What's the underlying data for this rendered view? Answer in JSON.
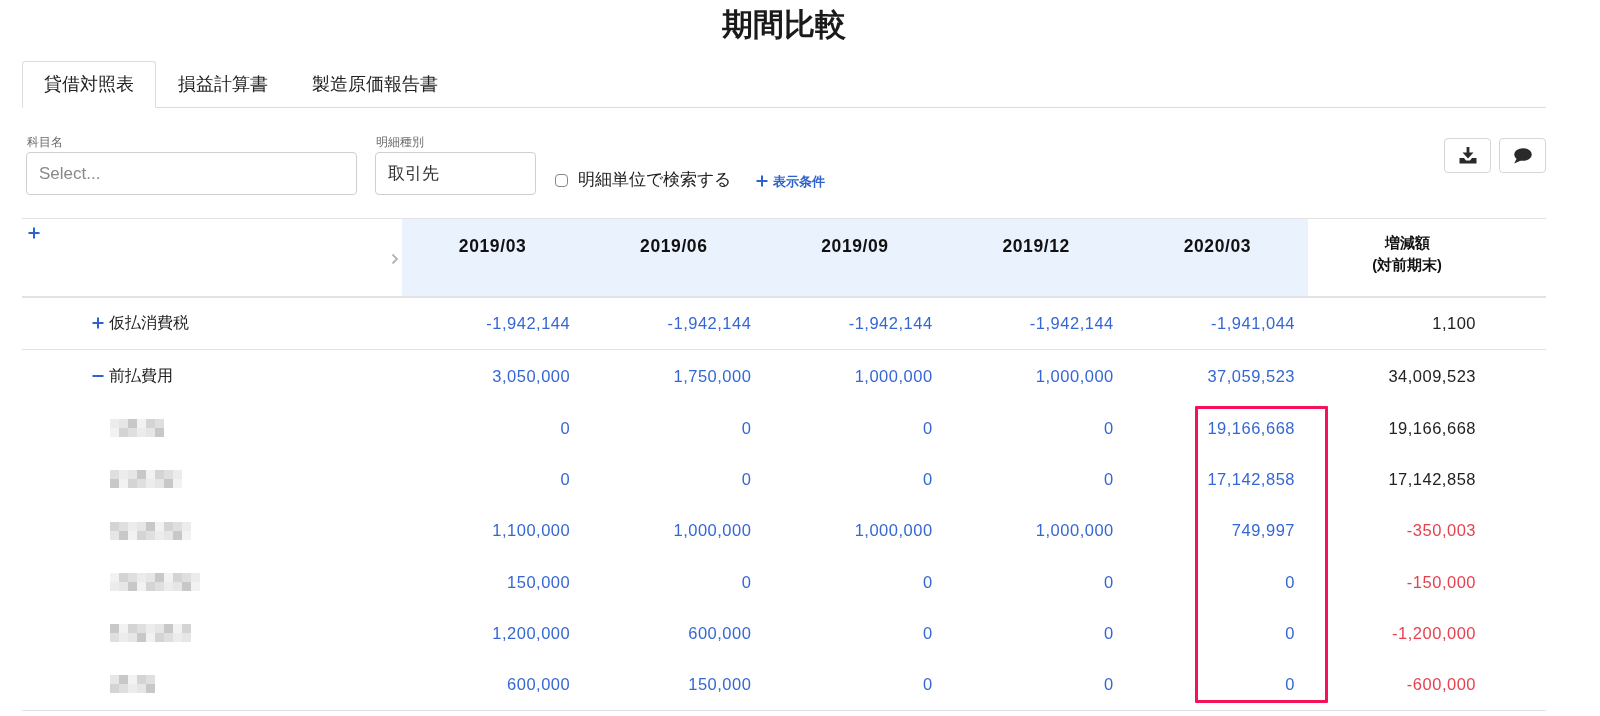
{
  "page": {
    "title": "期間比較"
  },
  "tabs": [
    {
      "label": "貸借対照表",
      "selected": true
    },
    {
      "label": "損益計算書",
      "selected": false
    },
    {
      "label": "製造原価報告書",
      "selected": false
    }
  ],
  "filters": {
    "account": {
      "label": "科目名",
      "placeholder": "Select..."
    },
    "detail_type": {
      "label": "明細種別",
      "value": "取引先"
    },
    "detail_search": {
      "label": "明細単位で検索する",
      "checked": false
    },
    "display_conditions": {
      "label": "表示条件"
    }
  },
  "table": {
    "columns": [
      "2019/03",
      "2019/06",
      "2019/09",
      "2019/12",
      "2020/03"
    ],
    "change_column": {
      "label": "増減額\n(対前期末)"
    },
    "highlight": {
      "kind": "latest_period_details_frame"
    },
    "rows": [
      {
        "kind": "account",
        "label": "仮払消費税",
        "expanded": false,
        "values": [
          "-1,942,144",
          "-1,942,144",
          "-1,942,144",
          "-1,942,144",
          "-1,941,044"
        ],
        "change": "1,100",
        "negative": false
      },
      {
        "kind": "account",
        "label": "前払費用",
        "expanded": true,
        "values": [
          "3,050,000",
          "1,750,000",
          "1,000,000",
          "1,000,000",
          "37,059,523"
        ],
        "change": "34,009,523",
        "negative": false,
        "children": [
          {
            "kind": "partner",
            "values": [
              "0",
              "0",
              "0",
              "0",
              "19,166,668"
            ],
            "change": "19,166,668",
            "negative": false
          },
          {
            "kind": "partner",
            "values": [
              "0",
              "0",
              "0",
              "0",
              "17,142,858"
            ],
            "change": "17,142,858",
            "negative": false
          },
          {
            "kind": "partner",
            "values": [
              "1,100,000",
              "1,000,000",
              "1,000,000",
              "1,000,000",
              "749,997"
            ],
            "change": "-350,003",
            "negative": true
          },
          {
            "kind": "partner",
            "values": [
              "150,000",
              "0",
              "0",
              "0",
              "0"
            ],
            "change": "-150,000",
            "negative": true
          },
          {
            "kind": "partner",
            "values": [
              "1,200,000",
              "600,000",
              "0",
              "0",
              "0"
            ],
            "change": "-1,200,000",
            "negative": true
          },
          {
            "kind": "partner",
            "values": [
              "600,000",
              "150,000",
              "0",
              "0",
              "0"
            ],
            "change": "-600,000",
            "negative": true
          }
        ]
      }
    ]
  }
}
